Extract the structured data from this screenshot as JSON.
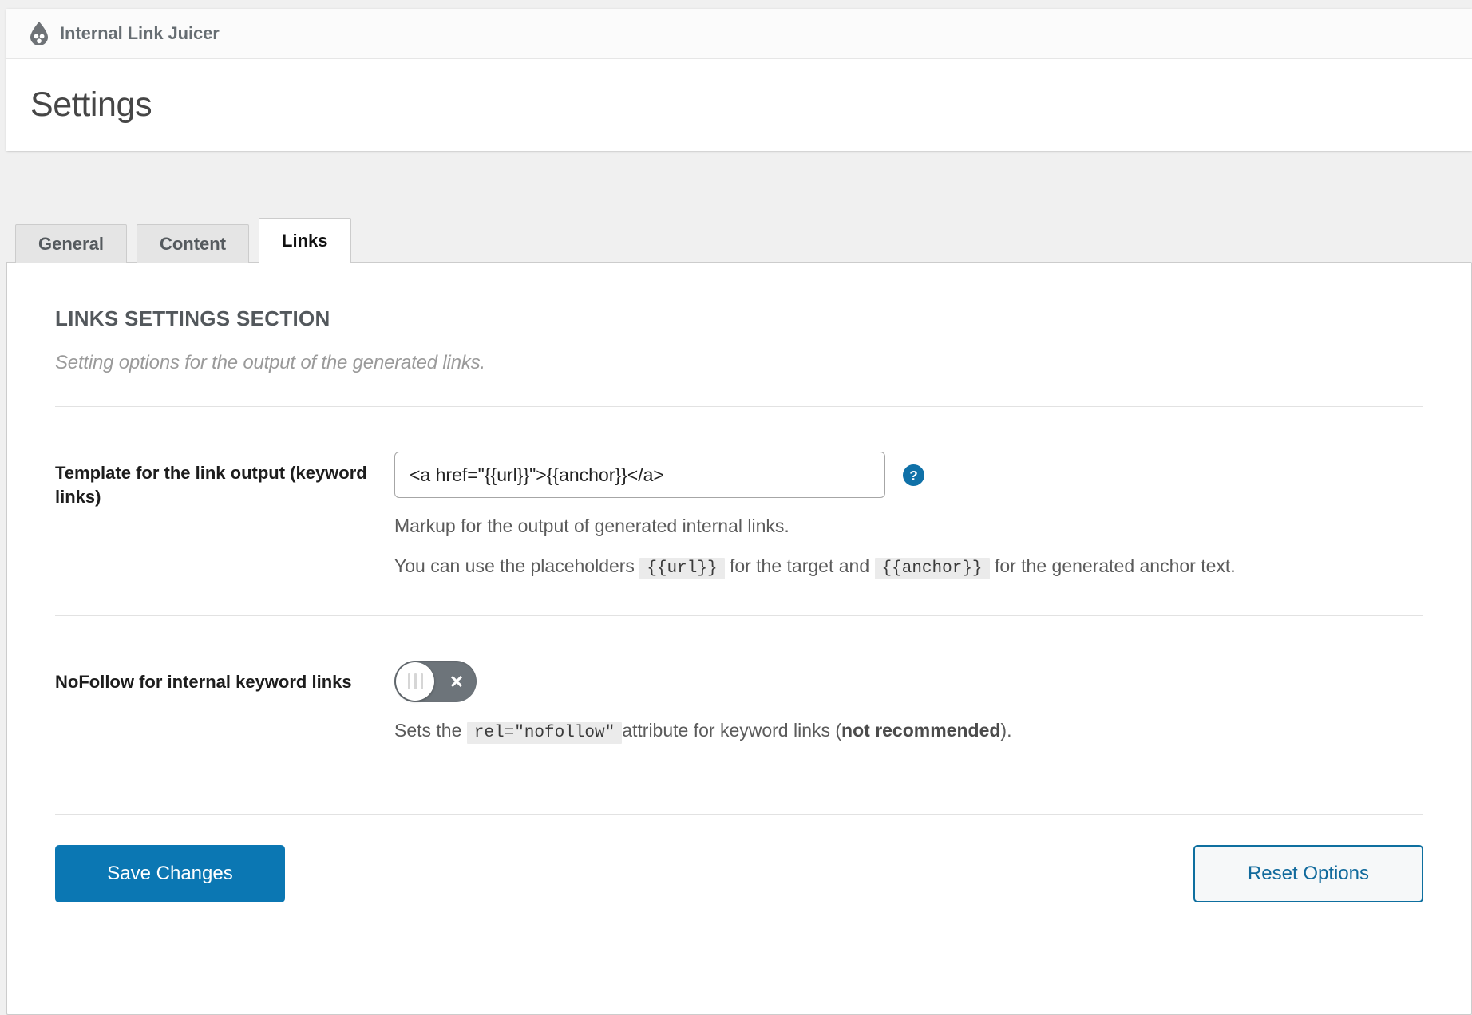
{
  "brand": {
    "name": "Internal Link Juicer",
    "logo_icon": "water-drop-icon"
  },
  "header": {
    "page_title": "Settings"
  },
  "tabs": [
    {
      "label": "General",
      "active": false
    },
    {
      "label": "Content",
      "active": false
    },
    {
      "label": "Links",
      "active": true
    }
  ],
  "section": {
    "heading": "LINKS SETTINGS SECTION",
    "subheading": "Setting options for the output of the generated links."
  },
  "fields": {
    "template": {
      "label": "Template for the link output (keyword links)",
      "value": "<a href=\"{{url}}\">{{anchor}}</a>",
      "help_icon": "question-mark-icon",
      "description": "Markup for the output of generated internal links.",
      "placeholders_text_1": "You can use the placeholders",
      "placeholder_url": "{{url}}",
      "placeholders_text_2": "for the target and",
      "placeholder_anchor": "{{anchor}}",
      "placeholders_text_3": "for the generated anchor text."
    },
    "nofollow": {
      "label": "NoFollow for internal keyword links",
      "state": "off",
      "toggle_icon": "close-x-icon",
      "description_text_1": "Sets the",
      "description_code": "rel=\"nofollow\"",
      "description_text_2": "attribute for keyword links (",
      "description_bold": "not recommended",
      "description_text_3": ")."
    }
  },
  "footer": {
    "save_label": "Save Changes",
    "reset_label": "Reset Options"
  },
  "colors": {
    "accent": "#0b77b3",
    "link": "#116a9c",
    "toggle_off": "#6d747a"
  }
}
